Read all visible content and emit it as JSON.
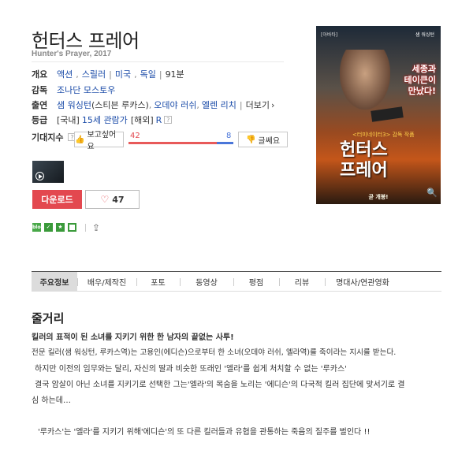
{
  "movie": {
    "title": "헌터스 프레어",
    "subtitle": "Hunter's Prayer, 2017"
  },
  "info": {
    "genre_label": "개요",
    "genres": [
      "액션",
      "스릴러"
    ],
    "countries": [
      "미국",
      "독일"
    ],
    "runtime": "91분",
    "director_label": "감독",
    "director": "조나단 모스토우",
    "cast_label": "출연",
    "cast_1": "샘 워싱턴",
    "cast_1_role": "(스티븐 루카스)",
    "cast_2": "오데야 러쉬",
    "cast_3": "엘렌 리치",
    "more": "더보기",
    "rating_label": "등급",
    "rating_domestic_prefix": "[국내]",
    "rating_domestic": "15세 관람가",
    "rating_foreign_prefix": "[해외]",
    "rating_foreign": "R"
  },
  "expect": {
    "label": "기대지수",
    "want_label": "보고싶어요",
    "want_count": "42",
    "not_label": "글쎄요",
    "not_count": "8",
    "want_ratio": 0.84
  },
  "actions": {
    "download": "다운로드",
    "like_count": "47"
  },
  "poster": {
    "top_credit": "[아바타]",
    "actor": "샘 워싱턴",
    "quote_line1": "세종과",
    "quote_line2": "테이큰이",
    "quote_line3": "만났다!",
    "sub": "<터미네이터3> 감독 작품",
    "main1": "헌터스",
    "main2": "프레어",
    "footer": "곧 개봉!"
  },
  "tabs": [
    "주요정보",
    "배우/제작진",
    "포토",
    "동영상",
    "평점",
    "리뷰",
    "명대사/연관영화"
  ],
  "synopsis": {
    "title": "줄거리",
    "tagline": "킬러의 표적이 된 소녀를 지키기 위한 한 남자의 끝없는 사투!",
    "p1": "전문 킬러(샘 워싱턴, 루카스역)는 고용인(에디슨)으로부터 한 소녀(오데야 러쉬, 엘라역)를 죽이라는 지시를 받는다.",
    "p2": "하지만 이전의 임무와는 달리, 자신의 딸과 비슷한 또래인 '엘라'를 쉽게 처치할 수 없는 '루카스'",
    "p3": "결국 암살이 아닌 소녀를 지키기로 선택한 그는'엘라'의 목숨을 노리는 '에디슨'의 다국적 킬러 집단에 맞서기로 결",
    "p4": "심 하는데…",
    "p5": "'루카스'는 '엘라'를 지키기 위해'에디슨'의 또 다른 킬러들과 유협을 관통하는 죽음의 질주를 벌인다 !!"
  }
}
